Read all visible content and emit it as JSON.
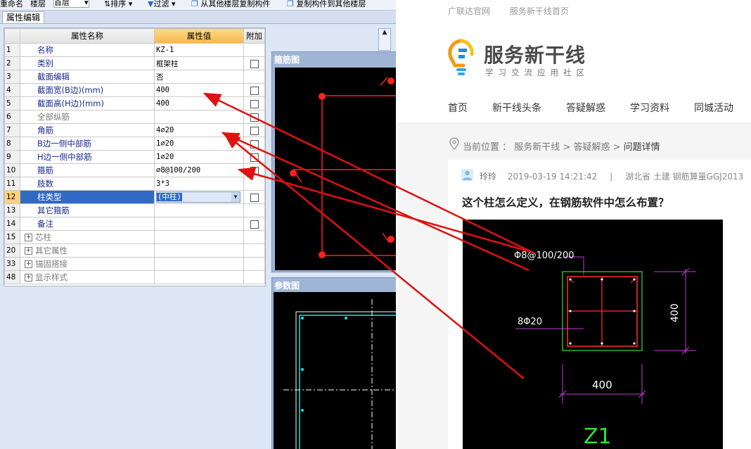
{
  "cad": {
    "toolbar": {
      "rename": "重命名",
      "floor_label": "楼层",
      "floor_value": "首层",
      "sort": "排序",
      "filter": "过滤",
      "copy_from": "从其他楼层复制构件",
      "copy_to": "复制构件到其他楼层"
    },
    "tab": "属性编辑",
    "grid": {
      "headers": {
        "name": "属性名称",
        "value": "属性值",
        "extra": "附加"
      },
      "rows": [
        {
          "num": "1",
          "name": "名称",
          "value": "KZ-1",
          "check": false
        },
        {
          "num": "2",
          "name": "类别",
          "value": "框架柱",
          "check": true
        },
        {
          "num": "3",
          "name": "截面编辑",
          "value": "否",
          "check": false
        },
        {
          "num": "4",
          "name": "截面宽(B边)(mm)",
          "value": "400",
          "check": true
        },
        {
          "num": "5",
          "name": "截面高(H边)(mm)",
          "value": "400",
          "check": true
        },
        {
          "num": "6",
          "name": "全部纵筋",
          "value": "",
          "check": true
        },
        {
          "num": "7",
          "name": "角筋",
          "value": "4⌀20",
          "check": true
        },
        {
          "num": "8",
          "name": "B边一侧中部筋",
          "value": "1⌀20",
          "check": true
        },
        {
          "num": "9",
          "name": "H边一侧中部筋",
          "value": "1⌀20",
          "check": true
        },
        {
          "num": "10",
          "name": "箍筋",
          "value": "⌀8@100/200",
          "check": true
        },
        {
          "num": "11",
          "name": "肢数",
          "value": "3*3",
          "check": false
        },
        {
          "num": "12",
          "name": "柱类型",
          "value": "(中柱)",
          "check": true
        },
        {
          "num": "13",
          "name": "其它箍筋",
          "value": "",
          "check": false
        },
        {
          "num": "14",
          "name": "备注",
          "value": "",
          "check": true
        },
        {
          "num": "15",
          "name": "芯柱",
          "value": "",
          "check": false
        },
        {
          "num": "20",
          "name": "其它属性",
          "value": "",
          "check": false
        },
        {
          "num": "33",
          "name": "锚固搭接",
          "value": "",
          "check": false
        },
        {
          "num": "48",
          "name": "显示样式",
          "value": "",
          "check": false
        }
      ]
    },
    "panel_stirrup": "箍筋图",
    "panel_param": "参数图"
  },
  "web": {
    "toplinks": [
      "广联达官网",
      "服务新干线首页"
    ],
    "logo_title": "服务新干线",
    "logo_sub": "学习交流应用社区",
    "nav": [
      "首页",
      "新干线头条",
      "答疑解惑",
      "学习资料",
      "同城活动"
    ],
    "breadcrumb": {
      "label": "当前位置 ：",
      "path": "服务新干线 > 答疑解惑 >",
      "current": "问题详情"
    },
    "meta": {
      "user": "玲玲",
      "datetime": "2019-03-19 14:21:42",
      "divider": "|",
      "tags": "湖北省  土建  钢筋算量GGJ2013"
    },
    "question_title": "这个柱怎么定义，在钢筋软件中怎么布置？",
    "drawing": {
      "stirrup_label": "Φ8@100/200",
      "bar_label": "8Φ20",
      "dim_right": "400",
      "dim_bottom": "400",
      "col_name": "Z1"
    }
  },
  "colors": {
    "grid_header_value": "#f5b84a",
    "selected_row": "#316ac5",
    "annotation_arrow": "#e01010",
    "logo_orange": "#f29a12",
    "logo_blue": "#1a8fe0"
  }
}
